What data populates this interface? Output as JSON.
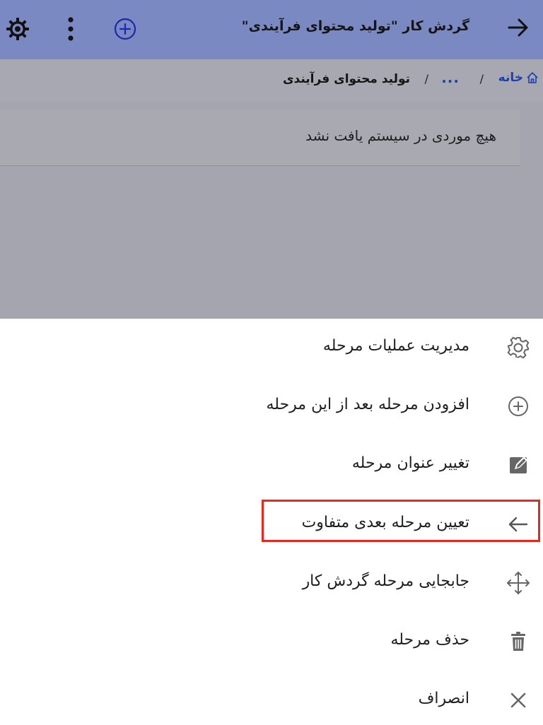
{
  "header": {
    "title": "گردش کار \"تولید محتوای فرآیندی\"",
    "back_icon": "arrow-right-icon",
    "add_icon": "plus-circle-icon",
    "more_icon": "more-vertical-icon",
    "settings_icon": "gear-icon",
    "background": "#7b89c2"
  },
  "breadcrumb": {
    "home": "خانه",
    "ellipsis": "...",
    "separator": "/",
    "current": "تولید محتوای فرآیندی",
    "link_color": "#1e3fb0"
  },
  "content": {
    "empty_message": "هیچ موردی در سیستم یافت نشد"
  },
  "menu": {
    "items": [
      {
        "label": "مدیریت عملیات مرحله",
        "icon": "gear-icon"
      },
      {
        "label": "افزودن مرحله بعد از این مرحله",
        "icon": "plus-circle-icon"
      },
      {
        "label": "تغییر عنوان مرحله",
        "icon": "edit-icon"
      },
      {
        "label": "تعیین مرحله بعدی متفاوت",
        "icon": "arrow-left-icon",
        "highlighted": true
      },
      {
        "label": "جابجایی مرحله گردش کار",
        "icon": "move-icon"
      },
      {
        "label": "حذف مرحله",
        "icon": "trash-icon"
      },
      {
        "label": "انصراف",
        "icon": "close-icon"
      }
    ],
    "highlight_color": "#e32a1f"
  }
}
